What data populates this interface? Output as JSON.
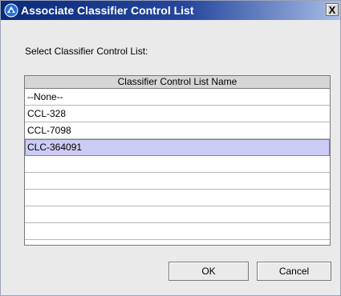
{
  "window": {
    "title": "Associate Classifier Control List",
    "close_glyph": "X",
    "title_icon": "app-icon"
  },
  "prompt": "Select Classifier Control List:",
  "list": {
    "column_header": "Classifier Control List Name",
    "rows": [
      "--None--",
      "CCL-328",
      "CCL-7098",
      "CLC-364091",
      "",
      "",
      "",
      "",
      ""
    ],
    "selected_index": 3
  },
  "buttons": {
    "ok_label": "OK",
    "cancel_label": "Cancel"
  },
  "colors": {
    "title_bar_start": "#0a2a7a",
    "selection": "#ccccf5"
  }
}
